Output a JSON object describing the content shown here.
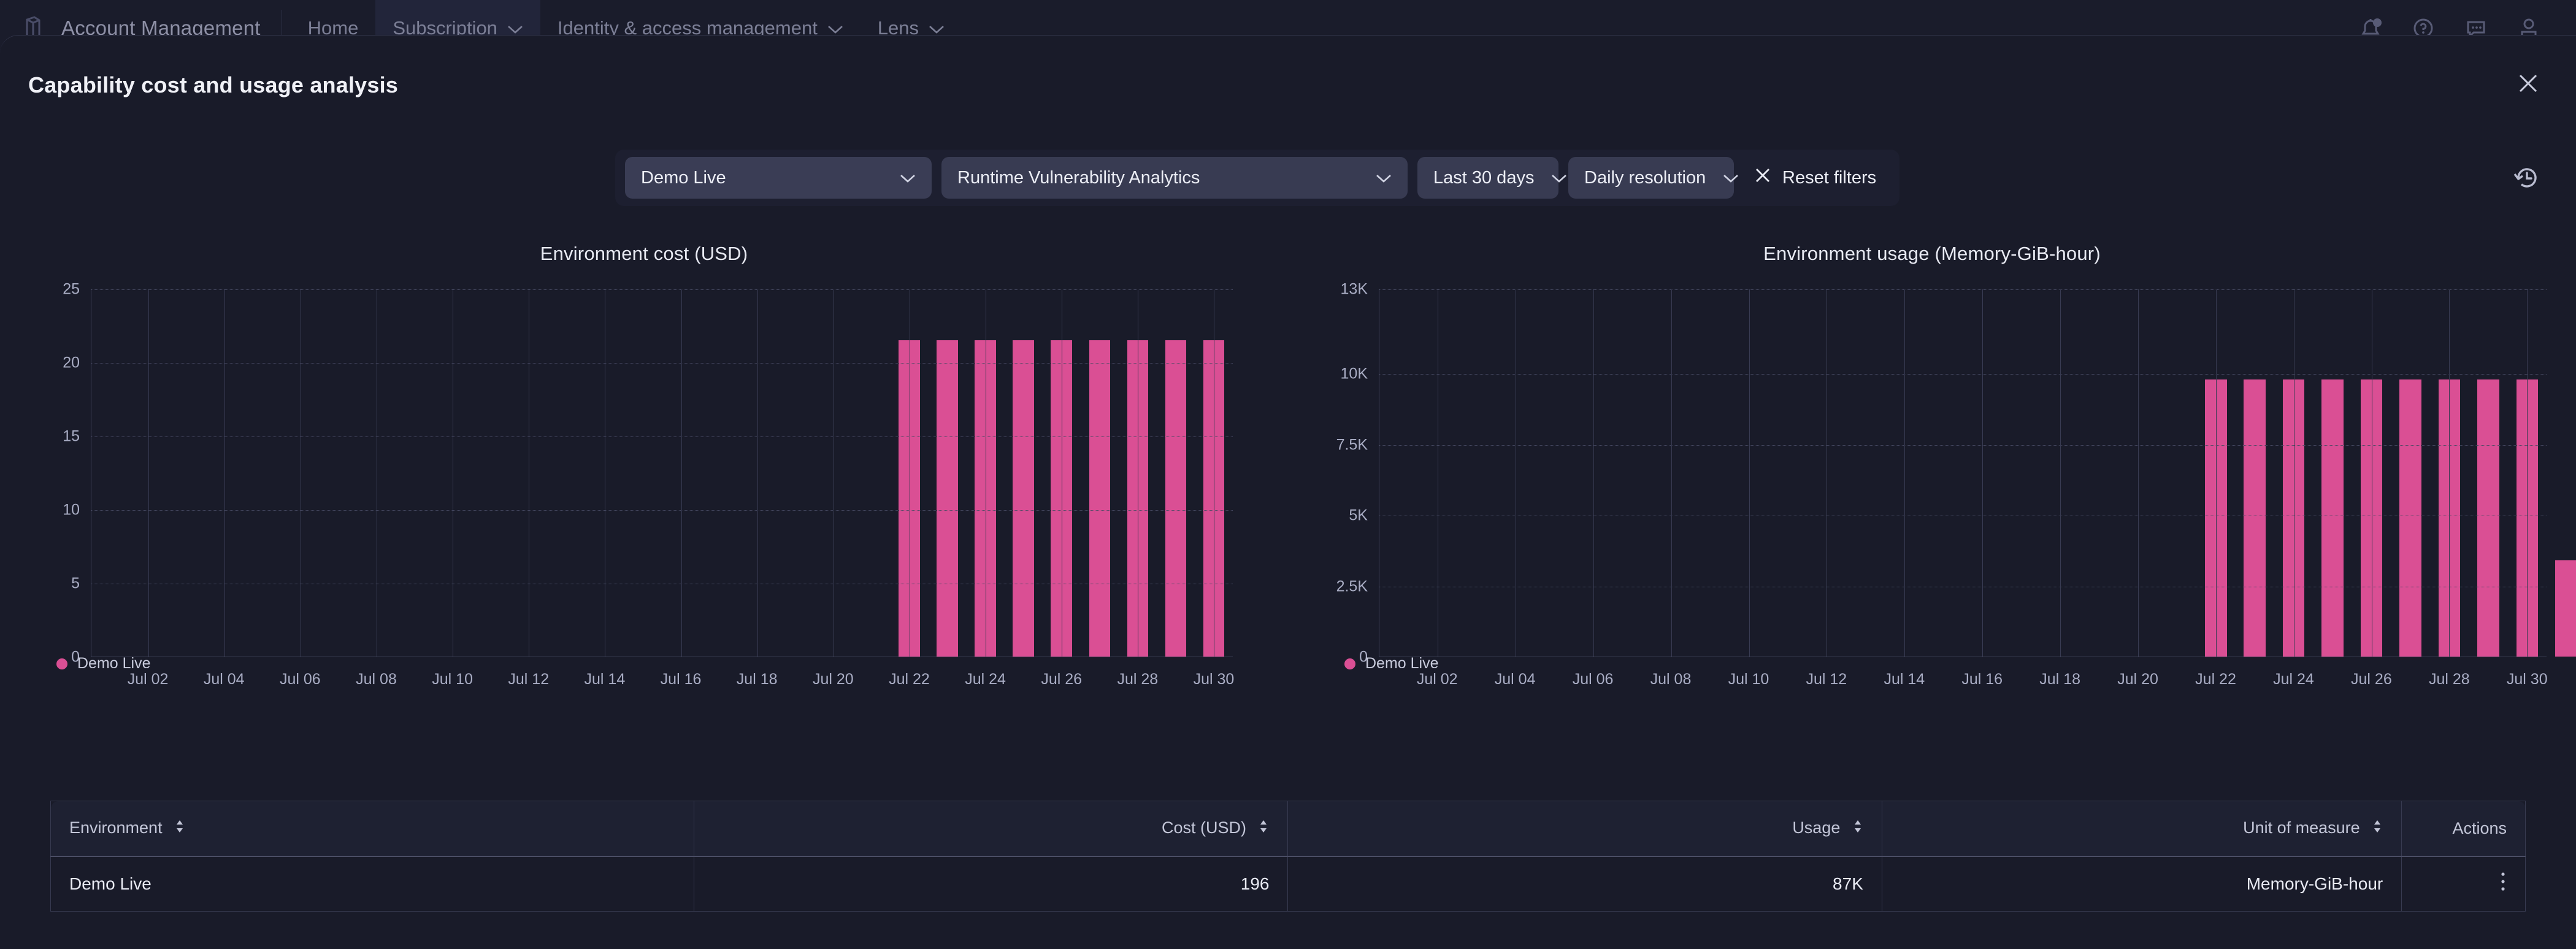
{
  "topnav": {
    "brand": "Account Management",
    "items": [
      {
        "label": "Home",
        "has_chevron": false,
        "active": false
      },
      {
        "label": "Subscription",
        "has_chevron": true,
        "active": true
      },
      {
        "label": "Identity & access management",
        "has_chevron": true,
        "active": false
      },
      {
        "label": "Lens",
        "has_chevron": true,
        "active": false
      }
    ],
    "right_icons": [
      "notifications-bell-icon",
      "help-circle-icon",
      "feedback-chat-icon",
      "user-account-icon"
    ]
  },
  "page": {
    "title": "Capability cost and usage analysis",
    "close_icon": "close-icon",
    "history_icon": "history-clock-icon"
  },
  "filters": {
    "environment": "Demo Live",
    "capability": "Runtime Vulnerability Analytics",
    "time_range": "Last 30 days",
    "resolution": "Daily resolution",
    "reset_label": "Reset filters",
    "reset_icon": "close-x-icon",
    "chevron_icon": "chevron-down-icon"
  },
  "legend": {
    "label": "Demo Live",
    "color": "#da4f94"
  },
  "chart_data": [
    {
      "type": "bar",
      "title": "Environment cost (USD)",
      "xlabel": "",
      "ylabel": "",
      "ylim": [
        0,
        25
      ],
      "yticks": [
        0,
        5,
        10,
        15,
        20,
        25
      ],
      "ytick_labels": [
        "0",
        "5",
        "10",
        "15",
        "20",
        "25"
      ],
      "grid": true,
      "legend_position": "bottom-left",
      "series_name": "Demo Live",
      "color": "#da4f94",
      "categories": [
        "Jul 01",
        "Jul 02",
        "Jul 03",
        "Jul 04",
        "Jul 05",
        "Jul 06",
        "Jul 07",
        "Jul 08",
        "Jul 09",
        "Jul 10",
        "Jul 11",
        "Jul 12",
        "Jul 13",
        "Jul 14",
        "Jul 15",
        "Jul 16",
        "Jul 17",
        "Jul 18",
        "Jul 19",
        "Jul 20",
        "Jul 21",
        "Jul 22",
        "Jul 23",
        "Jul 24",
        "Jul 25",
        "Jul 26",
        "Jul 27",
        "Jul 28",
        "Jul 29",
        "Jul 30"
      ],
      "values": [
        0,
        0,
        0,
        0,
        0,
        0,
        0,
        0,
        0,
        0,
        0,
        0,
        0,
        0,
        0,
        0,
        0,
        0,
        0,
        0,
        0,
        21.5,
        21.5,
        21.5,
        21.5,
        21.5,
        21.5,
        21.5,
        21.5,
        21.5,
        0
      ],
      "xtick_labels": [
        "Jul 02",
        "Jul 04",
        "Jul 06",
        "Jul 08",
        "Jul 10",
        "Jul 12",
        "Jul 14",
        "Jul 16",
        "Jul 18",
        "Jul 20",
        "Jul 22",
        "Jul 24",
        "Jul 26",
        "Jul 28",
        "Jul 30"
      ]
    },
    {
      "type": "bar",
      "title": "Environment usage (Memory-GiB-hour)",
      "xlabel": "",
      "ylabel": "",
      "ylim": [
        0,
        13000
      ],
      "yticks": [
        0,
        2500,
        5000,
        7500,
        10000,
        13000
      ],
      "ytick_labels": [
        "0",
        "2.5K",
        "5K",
        "7.5K",
        "10K",
        "13K"
      ],
      "grid": true,
      "legend_position": "bottom-left",
      "series_name": "Demo Live",
      "color": "#da4f94",
      "categories": [
        "Jul 01",
        "Jul 02",
        "Jul 03",
        "Jul 04",
        "Jul 05",
        "Jul 06",
        "Jul 07",
        "Jul 08",
        "Jul 09",
        "Jul 10",
        "Jul 11",
        "Jul 12",
        "Jul 13",
        "Jul 14",
        "Jul 15",
        "Jul 16",
        "Jul 17",
        "Jul 18",
        "Jul 19",
        "Jul 20",
        "Jul 21",
        "Jul 22",
        "Jul 23",
        "Jul 24",
        "Jul 25",
        "Jul 26",
        "Jul 27",
        "Jul 28",
        "Jul 29",
        "Jul 30"
      ],
      "values": [
        0,
        0,
        0,
        0,
        0,
        0,
        0,
        0,
        0,
        0,
        0,
        0,
        0,
        0,
        0,
        0,
        0,
        0,
        0,
        0,
        0,
        9800,
        9800,
        9800,
        9800,
        9800,
        9800,
        9800,
        9800,
        9800,
        3400
      ],
      "xtick_labels": [
        "Jul 02",
        "Jul 04",
        "Jul 06",
        "Jul 08",
        "Jul 10",
        "Jul 12",
        "Jul 14",
        "Jul 16",
        "Jul 18",
        "Jul 20",
        "Jul 22",
        "Jul 24",
        "Jul 26",
        "Jul 28",
        "Jul 30"
      ]
    }
  ],
  "table": {
    "columns": [
      {
        "label": "Environment",
        "align": "left",
        "sortable": true
      },
      {
        "label": "Cost (USD)",
        "align": "right",
        "sortable": true
      },
      {
        "label": "Usage",
        "align": "right",
        "sortable": true
      },
      {
        "label": "Unit of measure",
        "align": "right",
        "sortable": true
      },
      {
        "label": "Actions",
        "align": "right",
        "sortable": false
      }
    ],
    "rows": [
      {
        "environment": "Demo Live",
        "cost": "196",
        "usage": "87K",
        "unit": "Memory-GiB-hour",
        "actions_icon": "kebab-menu-icon"
      }
    ]
  }
}
